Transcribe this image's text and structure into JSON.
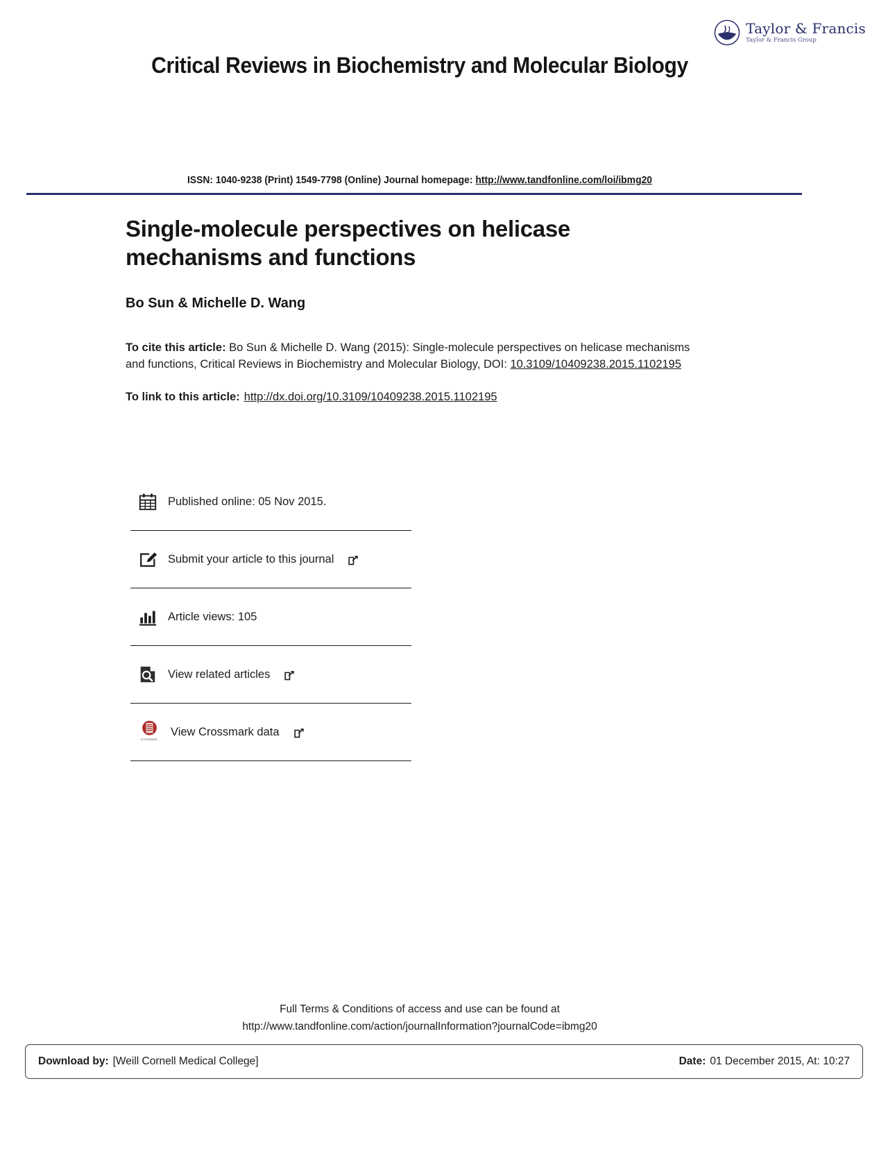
{
  "publisher": {
    "name": "Taylor & Francis",
    "group": "Taylor & Francis Group",
    "logo_color": "#2b2f6b",
    "mark_icon": "taylor-francis-globe-icon"
  },
  "journal": {
    "title": "Critical Reviews in Biochemistry and Molecular Biology",
    "issn_prefix": "ISSN: 1040-9238 (Print) 1549-7798 (Online) Journal homepage: ",
    "homepage_url": "http://www.tandfonline.com/loi/ibmg20",
    "rule_color": "#2b2f6b"
  },
  "article": {
    "title": "Single-molecule perspectives on helicase mechanisms and functions",
    "authors": "Bo Sun & Michelle D. Wang",
    "cite_label": "To cite this article:",
    "cite_text": " Bo Sun & Michelle D. Wang (2015): Single-molecule perspectives on helicase mechanisms and functions, Critical Reviews in Biochemistry and Molecular Biology, DOI: ",
    "doi": "10.3109/10409238.2015.1102195",
    "link_label": "To link to this article:",
    "link_url": "http://dx.doi.org/10.3109/10409238.2015.1102195"
  },
  "actions": [
    {
      "icon": "calendar-icon",
      "label": "Published online: 05 Nov 2015.",
      "external": false
    },
    {
      "icon": "submit-article-pencil-icon",
      "label": "Submit your article to this journal",
      "external": true
    },
    {
      "icon": "bar-chart-icon",
      "label": "Article views: 105",
      "external": false
    },
    {
      "icon": "related-articles-search-icon",
      "label": "View related articles",
      "external": true
    },
    {
      "icon": "crossmark-icon",
      "label": "View Crossmark data",
      "external": true,
      "badge_word": "CrossMark"
    }
  ],
  "footer": {
    "terms_line1": "Full Terms & Conditions of access and use can be found at",
    "terms_line2": "http://www.tandfonline.com/action/journalInformation?journalCode=ibmg20",
    "download_label": "Download by:",
    "download_value": "[Weill Cornell Medical College]",
    "date_label": "Date:",
    "date_value": "01 December 2015, At: 10:27"
  }
}
